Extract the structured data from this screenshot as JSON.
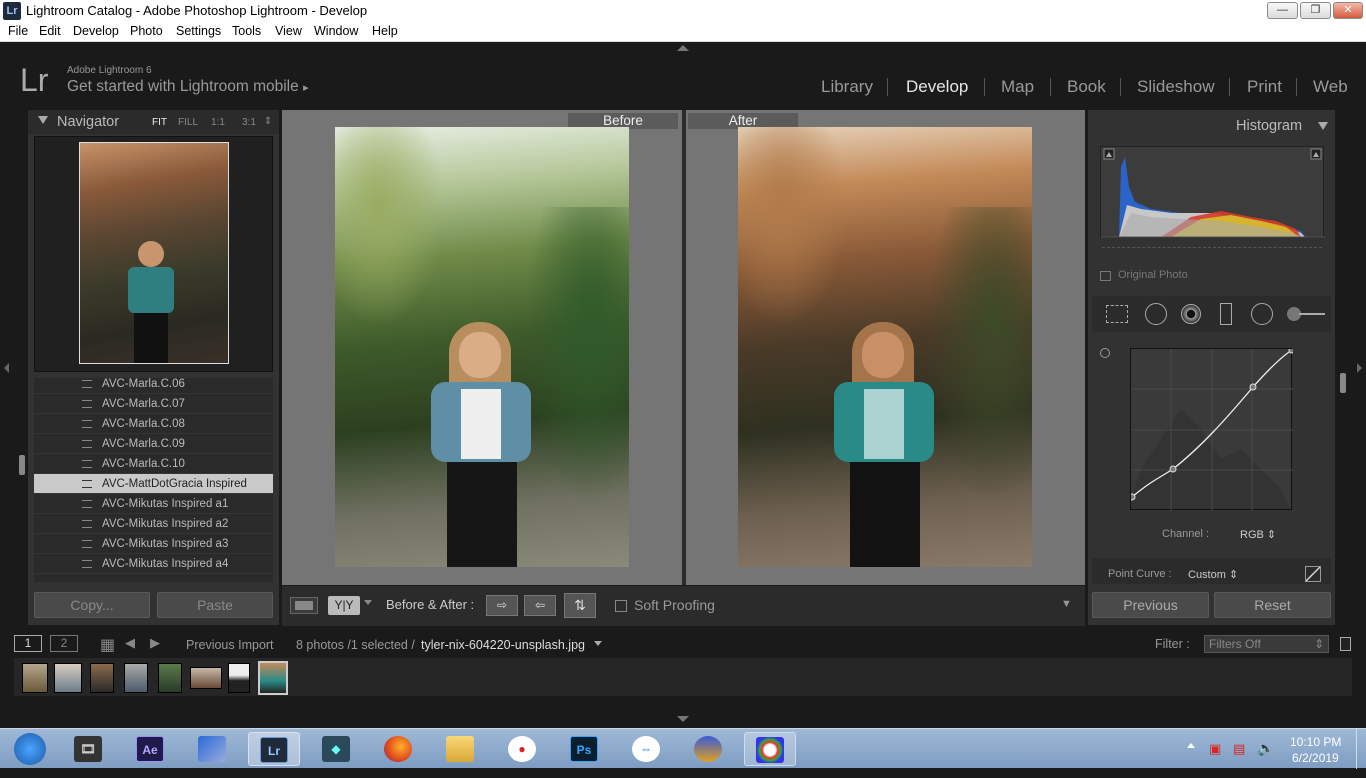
{
  "window": {
    "title": "Lightroom Catalog - Adobe Photoshop Lightroom - Develop",
    "app_icon": "Lr",
    "controls": {
      "minimize": "—",
      "restore": "❐",
      "close": "✕"
    }
  },
  "menu": [
    "File",
    "Edit",
    "Develop",
    "Photo",
    "Settings",
    "Tools",
    "View",
    "Window",
    "Help"
  ],
  "identity": {
    "logo": "Lr",
    "product": "Adobe Lightroom 6",
    "tagline": "Get started with Lightroom mobile",
    "arrow": "▸"
  },
  "modules": [
    "Library",
    "Develop",
    "Map",
    "Book",
    "Slideshow",
    "Print",
    "Web"
  ],
  "active_module": "Develop",
  "navigator": {
    "title": "Navigator",
    "zoom": [
      "FIT",
      "FILL",
      "1:1",
      "3:1"
    ],
    "zoom_arrows": "⇕"
  },
  "presets": [
    "AVC-Marla.C.06",
    "AVC-Marla.C.07",
    "AVC-Marla.C.08",
    "AVC-Marla.C.09",
    "AVC-Marla.C.10",
    "AVC-MattDotGracia Inspired",
    "AVC-Mikutas Inspired a1",
    "AVC-Mikutas Inspired a2",
    "AVC-Mikutas Inspired a3",
    "AVC-Mikutas Inspired a4"
  ],
  "selected_preset": "AVC-MattDotGracia Inspired",
  "left_buttons": {
    "copy": "Copy...",
    "paste": "Paste"
  },
  "compare": {
    "before": "Before",
    "after": "After"
  },
  "toolbar": {
    "view_label": "Before & After :",
    "yy": "Y|Y",
    "soft_proofing": "Soft Proofing",
    "menu_arrow": "▼"
  },
  "histogram": {
    "title": "Histogram",
    "original_photo": "Original Photo"
  },
  "tone_curve": {
    "channel_label": "Channel :",
    "channel_value": "RGB",
    "point_curve_label": "Point Curve :",
    "point_curve_value": "Custom"
  },
  "right_buttons": {
    "previous": "Previous",
    "reset": "Reset"
  },
  "filmstrip": {
    "page1": "1",
    "page2": "2",
    "source": "Previous Import",
    "count": "8 photos /1 selected /",
    "filename": "tyler-nix-604220-unsplash.jpg",
    "filter_label": "Filter :",
    "filter_value": "Filters Off"
  },
  "taskbar": {
    "time": "10:10 PM",
    "date": "6/2/2019",
    "apps": [
      "start",
      "video-editor",
      "after-effects",
      "app-diamond",
      "lightroom",
      "filmora",
      "firefox",
      "file-explorer",
      "screen-recorder",
      "photoshop",
      "teamviewer",
      "audio-app",
      "paint"
    ],
    "ae": "Ae",
    "lr": "Lr",
    "ps": "Ps"
  }
}
